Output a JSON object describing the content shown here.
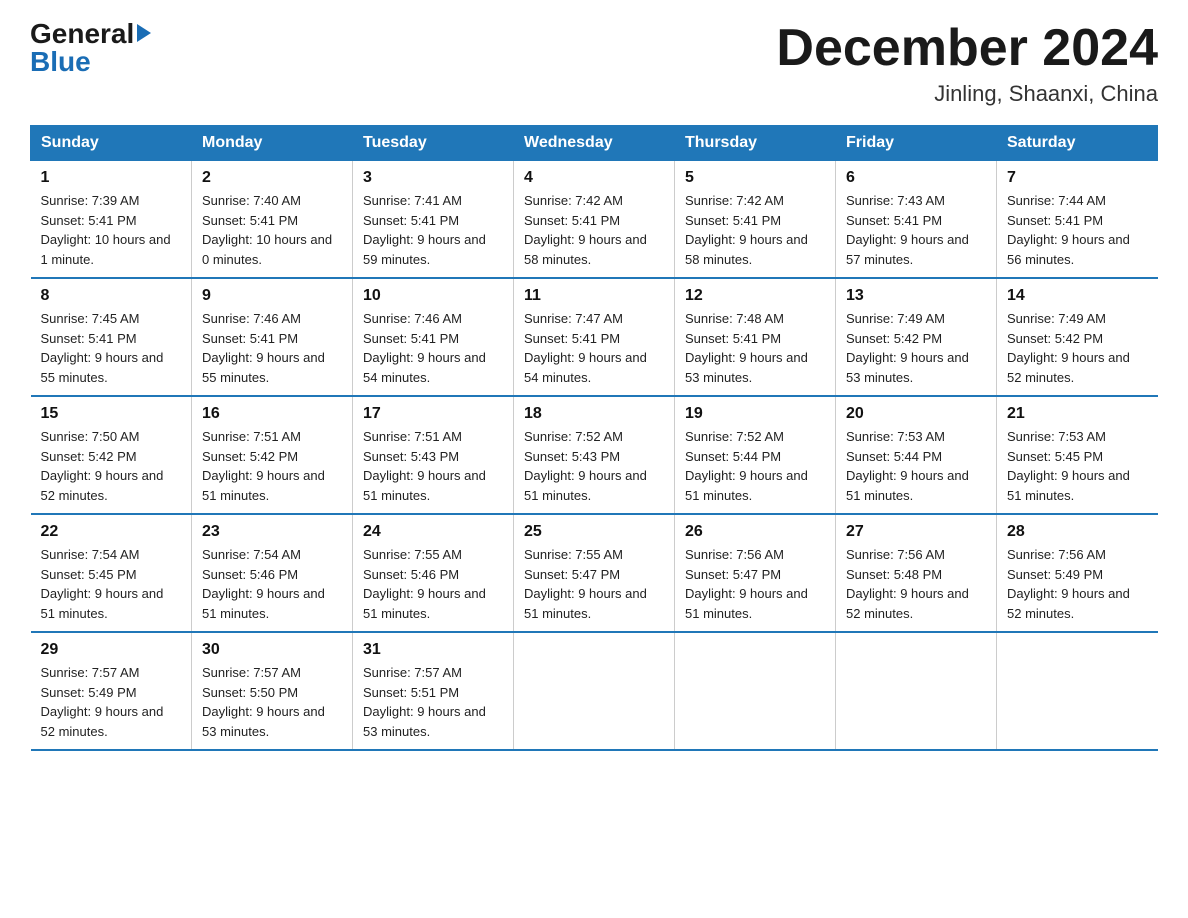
{
  "header": {
    "logo_general": "General",
    "logo_blue": "Blue",
    "month_title": "December 2024",
    "location": "Jinling, Shaanxi, China"
  },
  "weekdays": [
    "Sunday",
    "Monday",
    "Tuesday",
    "Wednesday",
    "Thursday",
    "Friday",
    "Saturday"
  ],
  "weeks": [
    [
      {
        "day": "1",
        "sunrise": "7:39 AM",
        "sunset": "5:41 PM",
        "daylight": "10 hours and 1 minute."
      },
      {
        "day": "2",
        "sunrise": "7:40 AM",
        "sunset": "5:41 PM",
        "daylight": "10 hours and 0 minutes."
      },
      {
        "day": "3",
        "sunrise": "7:41 AM",
        "sunset": "5:41 PM",
        "daylight": "9 hours and 59 minutes."
      },
      {
        "day": "4",
        "sunrise": "7:42 AM",
        "sunset": "5:41 PM",
        "daylight": "9 hours and 58 minutes."
      },
      {
        "day": "5",
        "sunrise": "7:42 AM",
        "sunset": "5:41 PM",
        "daylight": "9 hours and 58 minutes."
      },
      {
        "day": "6",
        "sunrise": "7:43 AM",
        "sunset": "5:41 PM",
        "daylight": "9 hours and 57 minutes."
      },
      {
        "day": "7",
        "sunrise": "7:44 AM",
        "sunset": "5:41 PM",
        "daylight": "9 hours and 56 minutes."
      }
    ],
    [
      {
        "day": "8",
        "sunrise": "7:45 AM",
        "sunset": "5:41 PM",
        "daylight": "9 hours and 55 minutes."
      },
      {
        "day": "9",
        "sunrise": "7:46 AM",
        "sunset": "5:41 PM",
        "daylight": "9 hours and 55 minutes."
      },
      {
        "day": "10",
        "sunrise": "7:46 AM",
        "sunset": "5:41 PM",
        "daylight": "9 hours and 54 minutes."
      },
      {
        "day": "11",
        "sunrise": "7:47 AM",
        "sunset": "5:41 PM",
        "daylight": "9 hours and 54 minutes."
      },
      {
        "day": "12",
        "sunrise": "7:48 AM",
        "sunset": "5:41 PM",
        "daylight": "9 hours and 53 minutes."
      },
      {
        "day": "13",
        "sunrise": "7:49 AM",
        "sunset": "5:42 PM",
        "daylight": "9 hours and 53 minutes."
      },
      {
        "day": "14",
        "sunrise": "7:49 AM",
        "sunset": "5:42 PM",
        "daylight": "9 hours and 52 minutes."
      }
    ],
    [
      {
        "day": "15",
        "sunrise": "7:50 AM",
        "sunset": "5:42 PM",
        "daylight": "9 hours and 52 minutes."
      },
      {
        "day": "16",
        "sunrise": "7:51 AM",
        "sunset": "5:42 PM",
        "daylight": "9 hours and 51 minutes."
      },
      {
        "day": "17",
        "sunrise": "7:51 AM",
        "sunset": "5:43 PM",
        "daylight": "9 hours and 51 minutes."
      },
      {
        "day": "18",
        "sunrise": "7:52 AM",
        "sunset": "5:43 PM",
        "daylight": "9 hours and 51 minutes."
      },
      {
        "day": "19",
        "sunrise": "7:52 AM",
        "sunset": "5:44 PM",
        "daylight": "9 hours and 51 minutes."
      },
      {
        "day": "20",
        "sunrise": "7:53 AM",
        "sunset": "5:44 PM",
        "daylight": "9 hours and 51 minutes."
      },
      {
        "day": "21",
        "sunrise": "7:53 AM",
        "sunset": "5:45 PM",
        "daylight": "9 hours and 51 minutes."
      }
    ],
    [
      {
        "day": "22",
        "sunrise": "7:54 AM",
        "sunset": "5:45 PM",
        "daylight": "9 hours and 51 minutes."
      },
      {
        "day": "23",
        "sunrise": "7:54 AM",
        "sunset": "5:46 PM",
        "daylight": "9 hours and 51 minutes."
      },
      {
        "day": "24",
        "sunrise": "7:55 AM",
        "sunset": "5:46 PM",
        "daylight": "9 hours and 51 minutes."
      },
      {
        "day": "25",
        "sunrise": "7:55 AM",
        "sunset": "5:47 PM",
        "daylight": "9 hours and 51 minutes."
      },
      {
        "day": "26",
        "sunrise": "7:56 AM",
        "sunset": "5:47 PM",
        "daylight": "9 hours and 51 minutes."
      },
      {
        "day": "27",
        "sunrise": "7:56 AM",
        "sunset": "5:48 PM",
        "daylight": "9 hours and 52 minutes."
      },
      {
        "day": "28",
        "sunrise": "7:56 AM",
        "sunset": "5:49 PM",
        "daylight": "9 hours and 52 minutes."
      }
    ],
    [
      {
        "day": "29",
        "sunrise": "7:57 AM",
        "sunset": "5:49 PM",
        "daylight": "9 hours and 52 minutes."
      },
      {
        "day": "30",
        "sunrise": "7:57 AM",
        "sunset": "5:50 PM",
        "daylight": "9 hours and 53 minutes."
      },
      {
        "day": "31",
        "sunrise": "7:57 AM",
        "sunset": "5:51 PM",
        "daylight": "9 hours and 53 minutes."
      },
      null,
      null,
      null,
      null
    ]
  ]
}
